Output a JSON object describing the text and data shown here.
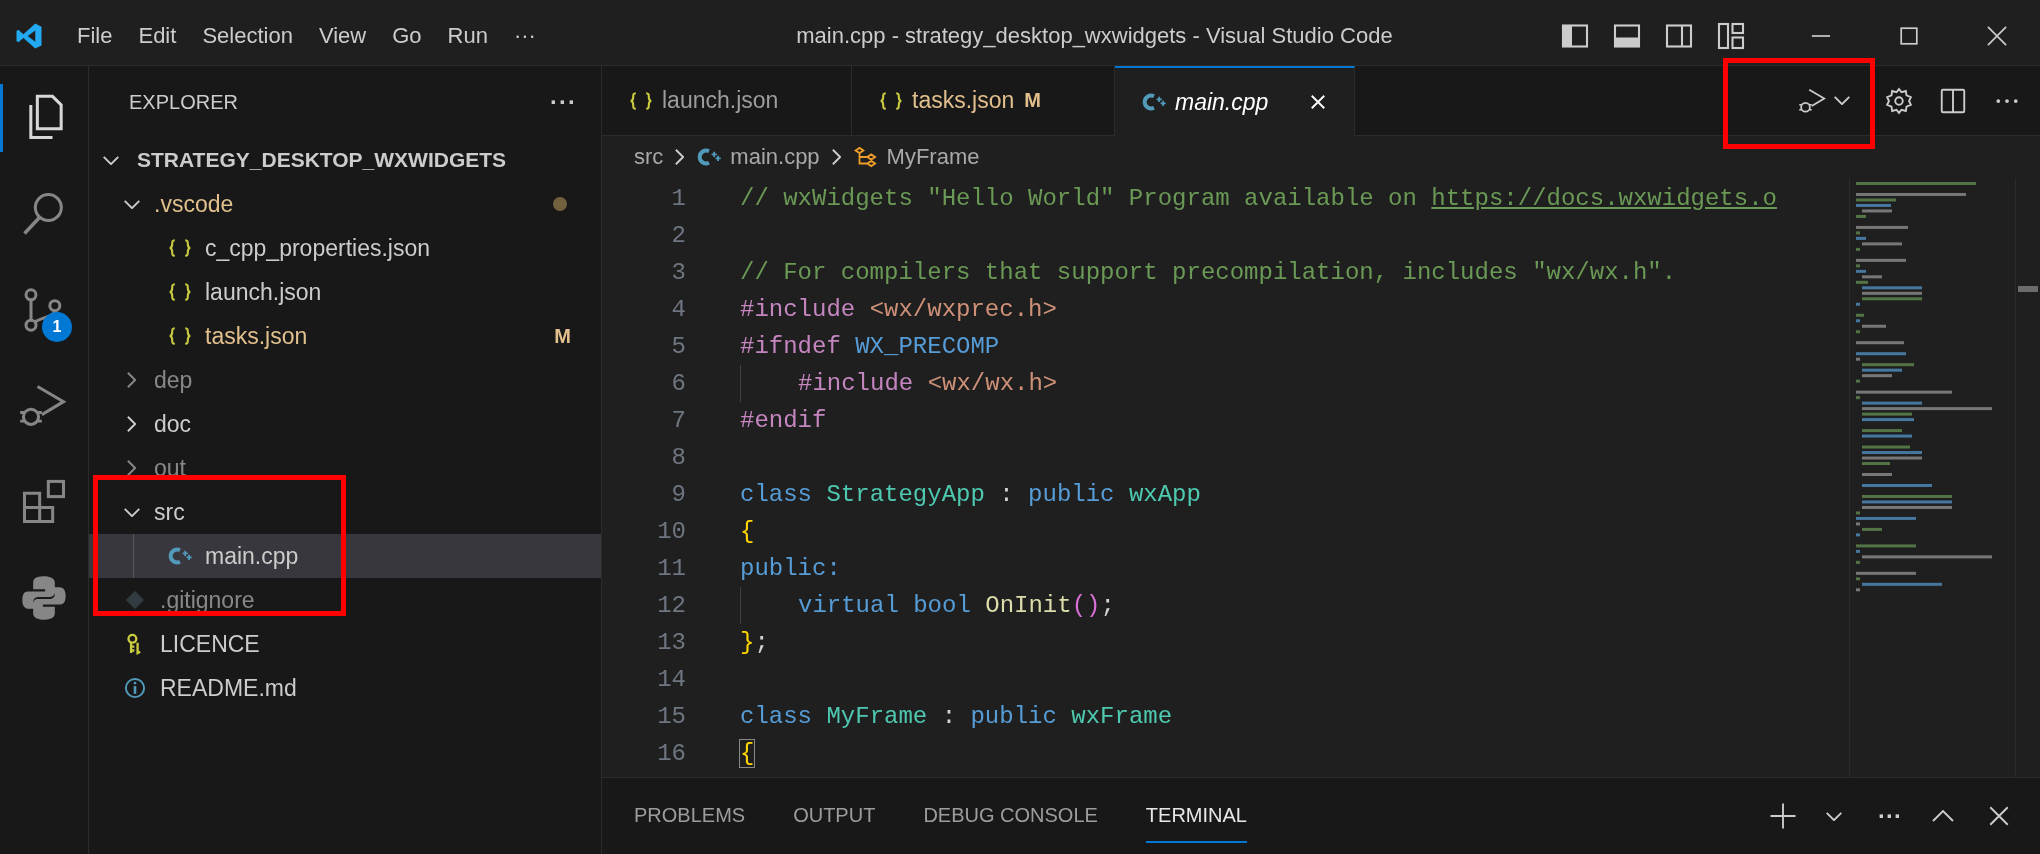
{
  "menu": [
    "File",
    "Edit",
    "Selection",
    "View",
    "Go",
    "Run",
    "···"
  ],
  "window": {
    "title": "main.cpp - strategy_desktop_wxwidgets - Visual Studio Code"
  },
  "activity_bar": [
    {
      "kind": "explorer",
      "selected": true
    },
    {
      "kind": "search",
      "selected": false
    },
    {
      "kind": "source-control",
      "selected": false,
      "badge": "1"
    },
    {
      "kind": "run-debug",
      "selected": false
    },
    {
      "kind": "extensions",
      "selected": false
    },
    {
      "kind": "python",
      "selected": false
    }
  ],
  "explorer": {
    "title": "EXPLORER",
    "more": "···",
    "root": {
      "label": "STRATEGY_DESKTOP_WXWIDGETS",
      "expanded": true,
      "children": [
        {
          "label": ".vscode",
          "kind": "folder",
          "expanded": true,
          "modified": true,
          "ignored": false,
          "selected": false,
          "children": [
            {
              "label": "c_cpp_properties.json",
              "kind": "json",
              "modified": false,
              "ignored": false,
              "selected": false
            },
            {
              "label": "launch.json",
              "kind": "json",
              "modified": false,
              "ignored": false,
              "selected": false
            },
            {
              "label": "tasks.json",
              "kind": "json",
              "modified": true,
              "ignored": false,
              "badge": "M",
              "selected": false
            }
          ]
        },
        {
          "label": "dep",
          "kind": "folder",
          "expanded": false,
          "modified": false,
          "ignored": true,
          "selected": false
        },
        {
          "label": "doc",
          "kind": "folder",
          "expanded": false,
          "modified": false,
          "ignored": false,
          "selected": false
        },
        {
          "label": "out",
          "kind": "folder",
          "expanded": false,
          "modified": false,
          "ignored": true,
          "selected": false
        },
        {
          "label": "src",
          "kind": "folder",
          "expanded": true,
          "modified": false,
          "ignored": false,
          "selected": false,
          "children": [
            {
              "label": "main.cpp",
              "kind": "cpp",
              "modified": false,
              "ignored": false,
              "selected": true
            }
          ]
        },
        {
          "label": ".gitignore",
          "kind": "git",
          "modified": false,
          "ignored": true,
          "selected": false
        },
        {
          "label": "LICENCE",
          "kind": "license",
          "modified": false,
          "ignored": false,
          "selected": false
        },
        {
          "label": "README.md",
          "kind": "info",
          "modified": false,
          "ignored": false,
          "selected": false
        }
      ]
    }
  },
  "tabs": [
    {
      "label": "launch.json",
      "kind": "json",
      "selected": false,
      "modified": false
    },
    {
      "label": "tasks.json",
      "kind": "json",
      "selected": false,
      "modified": true,
      "badge": "M"
    },
    {
      "label": "main.cpp",
      "kind": "cpp",
      "selected": true,
      "modified": false
    }
  ],
  "breadcrumb": [
    {
      "label": "src",
      "kind": "folder"
    },
    {
      "label": "main.cpp",
      "kind": "cpp"
    },
    {
      "label": "MyFrame",
      "kind": "class"
    }
  ],
  "code": [
    {
      "number": "1",
      "tokens": [
        {
          "kind": "comment",
          "text": "// wxWidgets \"Hello World\" Program available on "
        },
        {
          "kind": "link",
          "text": "https://docs.wxwidgets.o"
        }
      ]
    },
    {
      "number": "2"
    },
    {
      "number": "3",
      "tokens": [
        {
          "kind": "comment",
          "text": "// For compilers that support precompilation, includes \"wx/wx.h\"."
        }
      ]
    },
    {
      "number": "4",
      "tokens": [
        {
          "kind": "preproc",
          "text": "#include "
        },
        {
          "kind": "string",
          "text": "<wx/wxprec.h>"
        }
      ]
    },
    {
      "number": "5",
      "tokens": [
        {
          "kind": "preproc",
          "text": "#ifndef "
        },
        {
          "kind": "macro",
          "text": "WX_PRECOMP"
        }
      ]
    },
    {
      "number": "6",
      "indented": true,
      "tokens": [
        {
          "kind": "preproc",
          "text": "#include "
        },
        {
          "kind": "string",
          "text": "<wx/wx.h>"
        }
      ]
    },
    {
      "number": "7",
      "tokens": [
        {
          "kind": "preproc",
          "text": "#endif"
        }
      ]
    },
    {
      "number": "8"
    },
    {
      "number": "9",
      "tokens": [
        {
          "kind": "keyword",
          "text": "class "
        },
        {
          "kind": "type",
          "text": "StrategyApp"
        },
        {
          "kind": "punct",
          "text": " : "
        },
        {
          "kind": "keyword",
          "text": "public "
        },
        {
          "kind": "type",
          "text": "wxApp"
        }
      ]
    },
    {
      "number": "10",
      "tokens": [
        {
          "kind": "brace",
          "text": "{"
        }
      ]
    },
    {
      "number": "11",
      "tokens": [
        {
          "kind": "keyword",
          "text": "public:"
        }
      ]
    },
    {
      "number": "12",
      "indented": true,
      "tokens": [
        {
          "kind": "keyword",
          "text": "virtual bool "
        },
        {
          "kind": "func",
          "text": "OnInit"
        },
        {
          "kind": "paren",
          "text": "()"
        },
        {
          "kind": "punct",
          "text": ";"
        }
      ]
    },
    {
      "number": "13",
      "tokens": [
        {
          "kind": "brace",
          "text": "}"
        },
        {
          "kind": "punct",
          "text": ";"
        }
      ]
    },
    {
      "number": "14"
    },
    {
      "number": "15",
      "tokens": [
        {
          "kind": "keyword",
          "text": "class "
        },
        {
          "kind": "type",
          "text": "MyFrame"
        },
        {
          "kind": "punct",
          "text": " : "
        },
        {
          "kind": "keyword",
          "text": "public "
        },
        {
          "kind": "type",
          "text": "wxFrame"
        }
      ]
    },
    {
      "number": "16",
      "tokens": [
        {
          "kind": "brace-match",
          "text": "{"
        }
      ]
    }
  ],
  "panel": {
    "tabs": [
      {
        "label": "PROBLEMS",
        "selected": false
      },
      {
        "label": "OUTPUT",
        "selected": false
      },
      {
        "label": "DEBUG CONSOLE",
        "selected": false
      },
      {
        "label": "TERMINAL",
        "selected": true
      }
    ],
    "more": "···"
  }
}
